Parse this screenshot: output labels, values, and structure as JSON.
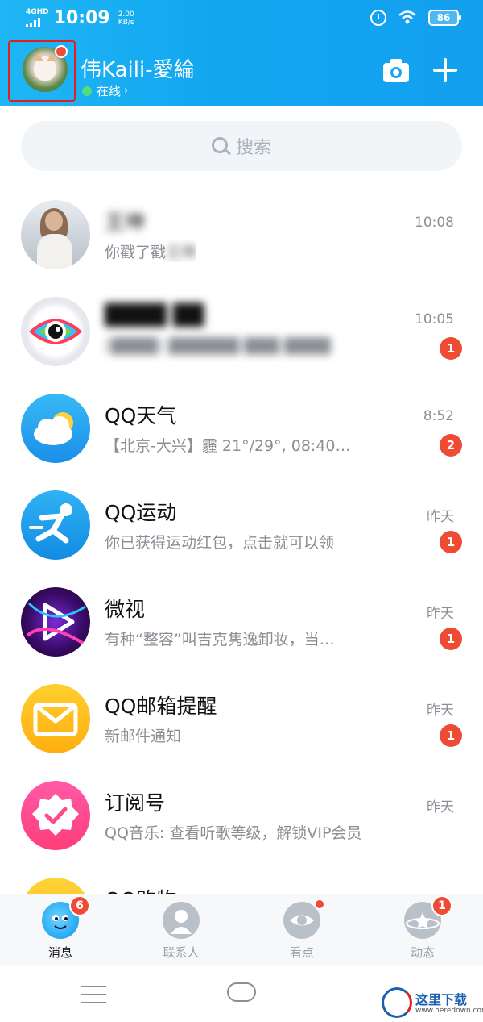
{
  "status_bar": {
    "network": "4GHD",
    "time": "10:09",
    "speed_value": "2.00",
    "speed_unit": "KB/s",
    "battery": "86"
  },
  "header": {
    "nickname": "伟Kaili-愛綸",
    "status": "在线",
    "status_chevron": "›"
  },
  "search": {
    "placeholder": "搜索"
  },
  "conversations": [
    {
      "name": "王坤",
      "preview": "你戳了戳王坤",
      "time": "10:08",
      "badge": "",
      "icon": "girl-avatar"
    },
    {
      "name": "████ ██",
      "preview": "[████] ██████ ███ ████",
      "time": "10:05",
      "badge": "1",
      "icon": "eye-icon"
    },
    {
      "name": "QQ天气",
      "preview": "【北京-大兴】霾 21°/29°, 08:40…",
      "time": "8:52",
      "badge": "2",
      "icon": "weather-icon"
    },
    {
      "name": "QQ运动",
      "preview": "你已获得运动红包，点击就可以领",
      "time": "昨天",
      "badge": "1",
      "icon": "running-icon"
    },
    {
      "name": "微视",
      "preview": "有种“整容”叫吉克隽逸卸妆，当…",
      "time": "昨天",
      "badge": "1",
      "icon": "play-icon"
    },
    {
      "name": "QQ邮箱提醒",
      "preview": "新邮件通知",
      "time": "昨天",
      "badge": "1",
      "icon": "mail-icon"
    },
    {
      "name": "订阅号",
      "preview": "QQ音乐: 查看听歌等级，解锁VIP会员",
      "time": "昨天",
      "badge": "",
      "icon": "check-badge-icon"
    },
    {
      "name": "QQ购物",
      "preview": "",
      "time": "",
      "badge": "",
      "icon": "shop-icon"
    }
  ],
  "tabs": [
    {
      "label": "消息",
      "badge": "6",
      "active": true
    },
    {
      "label": "联系人",
      "badge": "",
      "active": false
    },
    {
      "label": "看点",
      "badge": "dot",
      "active": false
    },
    {
      "label": "动态",
      "badge": "1",
      "active": false
    }
  ],
  "watermark": {
    "text": "这里下载",
    "url": "www.heredown.com"
  },
  "colors": {
    "header_start": "#1fb6f5",
    "header_end": "#13a0ef",
    "badge_red": "#ef4a34",
    "online_green": "#4fe07a"
  }
}
